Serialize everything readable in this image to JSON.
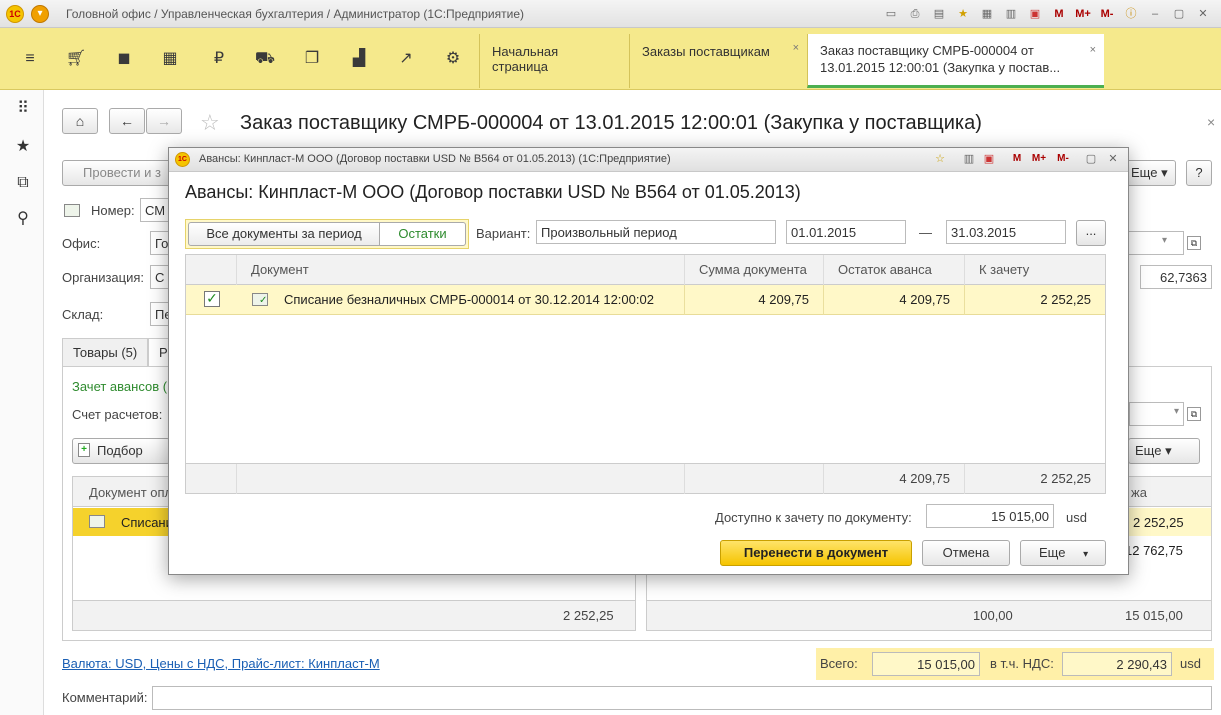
{
  "app": {
    "title": "Головной офис / Управленческая бухгалтерия / Администратор  (1С:Предприятие)",
    "logo": "1С",
    "titlebar_icons": [
      "monitor-icon",
      "print-icon",
      "print-preview-icon",
      "favorite-icon",
      "clipboard-icon",
      "calculator-icon",
      "calendar-icon"
    ],
    "m_labels": [
      "M",
      "M+",
      "M-"
    ]
  },
  "toolbar": {
    "tools": [
      "menu-icon",
      "cart-icon",
      "bag-icon",
      "grid-icon",
      "ruble-icon",
      "truck-icon",
      "documents-icon",
      "chart-bar-icon",
      "trend-icon",
      "gear-icon"
    ],
    "tabs": [
      {
        "label": "Начальная страница"
      },
      {
        "label": "Заказы поставщикам",
        "close": "×"
      },
      {
        "label": "Заказ поставщику СМРБ-000004 от 13.01.2015 12:00:01 (Закупка у постав...",
        "close": "×"
      }
    ]
  },
  "form": {
    "title": "Заказ поставщику СМРБ-000004 от 13.01.2015 12:00:01 (Закупка у поставщика)",
    "post_button": "Провести и з",
    "number_label": "Номер:",
    "number_value": "СМ",
    "office_label": "Офис:",
    "office_value": "Го",
    "org_label": "Организация:",
    "org_value": "С",
    "warehouse_label": "Склад:",
    "warehouse_value": "Пе",
    "rate_value": "62,7363",
    "more_label": "Еще",
    "help_label": "?",
    "tabs": [
      "Товары (5)",
      "Р"
    ],
    "advance_offset_label": "Зачет авансов (",
    "settlement_account_label": "Счет расчетов:",
    "pick_button": "Подбор",
    "more_button": "Еще",
    "bg_table": {
      "col_doc": "Документ опл",
      "col_right": "жа",
      "row1_doc": "Списани",
      "row1_right": "2 252,25",
      "row2_right": "12 762,75",
      "foot_left": "2 252,25",
      "foot_mid": "100,00",
      "foot_right": "15 015,00"
    },
    "currency_link": "Валюта: USD, Цены с НДС, Прайс-лист: Кинпласт-М",
    "total_label": "Всего:",
    "total_value": "15 015,00",
    "vat_label": "в т.ч. НДС:",
    "vat_value": "2 290,43",
    "currency": "usd",
    "comment_label": "Комментарий:"
  },
  "modal": {
    "window_title": "Авансы: Кинпласт-М ООО (Договор поставки USD № B564 от 01.05.2013)  (1С:Предприятие)",
    "title": "Авансы: Кинпласт-М ООО (Договор поставки USD № B564 от 01.05.2013)",
    "seg_all": "Все документы за период",
    "seg_rest": "Остатки",
    "variant_label": "Вариант:",
    "variant_value": "Произвольный период",
    "date_from": "01.01.2015",
    "dash": "—",
    "date_to": "31.03.2015",
    "dots": "...",
    "columns": {
      "document": "Документ",
      "sum": "Сумма документа",
      "rest": "Остаток аванса",
      "offset": "К зачету"
    },
    "rows": [
      {
        "checked": true,
        "document": "Списание безналичных СМРБ-000014 от 30.12.2014 12:00:02",
        "sum": "4 209,75",
        "rest": "4 209,75",
        "offset": "2 252,25"
      }
    ],
    "totals": {
      "rest": "4 209,75",
      "offset": "2 252,25"
    },
    "available_label": "Доступно к зачету по документу:",
    "available_value": "15 015,00",
    "available_currency": "usd",
    "transfer_button": "Перенести в документ",
    "cancel_button": "Отмена",
    "more_button": "Еще"
  }
}
